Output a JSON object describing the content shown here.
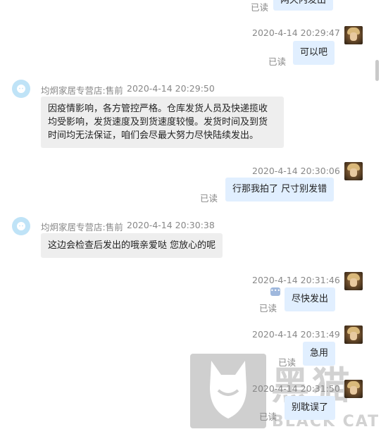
{
  "messages": [
    {
      "type": "out",
      "read": "已读",
      "text": "两天内发出"
    },
    {
      "type": "out",
      "time": "2020-4-14 20:29:47",
      "read": "已读",
      "text": "可以吧"
    },
    {
      "type": "in",
      "sender": "均炯家居专营店:售前",
      "time": "2020-4-14 20:29:50",
      "lines": [
        "因疫情影响，各方管控严格。仓库发货人员及快递揽收",
        "均受影响，发货速度及到货速度较慢。发货时间及到货",
        "时间均无法保证，咱们会尽最大努力尽快陆续发出。"
      ]
    },
    {
      "type": "out",
      "time": "2020-4-14 20:30:06",
      "read": "已读",
      "text": "行那我拍了 尺寸别发错"
    },
    {
      "type": "in",
      "sender": "均炯家居专营店:售前",
      "time": "2020-4-14 20:30:38",
      "lines": [
        "这边会检查后发出的哦亲爱哒 您放心的呢"
      ]
    },
    {
      "type": "out",
      "time": "2020-4-14 20:31:46",
      "read": "已读",
      "text": "尽快发出"
    },
    {
      "type": "out",
      "time": "2020-4-14 20:31:49",
      "read": "已读",
      "text": "急用"
    },
    {
      "type": "out",
      "time": "2020-4-14 20:31:50",
      "read": "已读",
      "text": "别耽误了"
    }
  ],
  "watermark": {
    "cn": "黑猫",
    "en": "BLACK CAT"
  },
  "icons": {
    "my_avatar": "user-avatar-icon",
    "shop_avatar": "shop-avatar-icon",
    "typing": "typing-indicator-icon"
  }
}
